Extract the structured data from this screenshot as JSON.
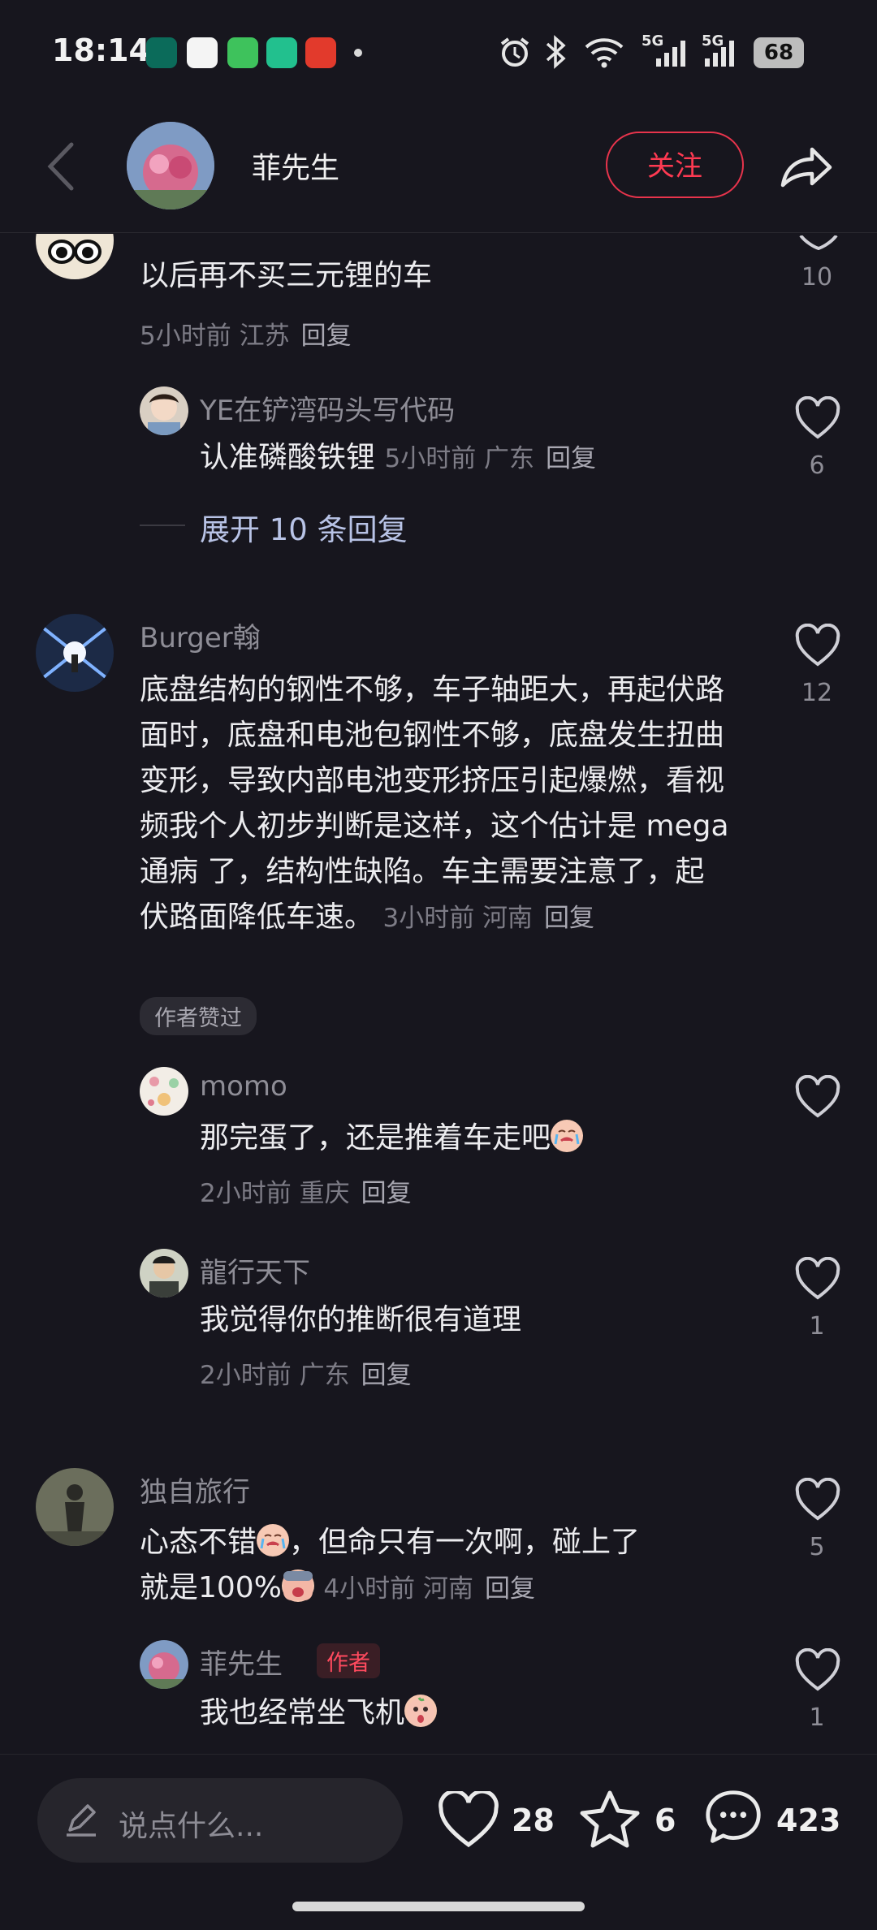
{
  "status_bar": {
    "time": "18:14",
    "net1": "5G",
    "net2": "5G",
    "battery": "68"
  },
  "header": {
    "author": "菲先生",
    "follow_label": "关注"
  },
  "comments": [
    {
      "text": "以后再不买三元锂的车",
      "meta": "5小时前 江苏",
      "reply": "回复",
      "likes": "10",
      "replies": [
        {
          "name": "YE在铲湾码头写代码",
          "text": "认准磷酸铁锂",
          "meta": "5小时前 广东",
          "reply": "回复",
          "likes": "6"
        }
      ],
      "expand": "展开 10 条回复"
    },
    {
      "name": "Burger翰",
      "text": "底盘结构的钢性不够，车子轴距大，再起伏路面时，底盘和电池包钢性不够，底盘发生扭曲变形，导致内部电池变形挤压引起爆燃，看视频我个人初步判断是这样，这个估计是 mega通病 了，结构性缺陷。车主需要注意了，起伏路面降低车速。",
      "meta": "3小时前 河南",
      "reply": "回复",
      "likes": "12",
      "badge": "作者赞过",
      "replies": [
        {
          "name": "momo",
          "text": "那完蛋了，还是推着车走吧",
          "meta": "2小时前 重庆",
          "reply": "回复",
          "likes": ""
        },
        {
          "name": "龍行天下",
          "text": "我觉得你的推断很有道理",
          "meta": "2小时前 广东",
          "reply": "回复",
          "likes": "1"
        }
      ]
    },
    {
      "name": "独自旅行",
      "text_a": "心态不错",
      "text_b": "，但命只有一次啊，碰上了",
      "text_c": "就是100%",
      "meta": "4小时前 河南",
      "reply": "回复",
      "likes": "5",
      "replies": [
        {
          "name": "菲先生",
          "tag": "作者",
          "text": "我也经常坐飞机",
          "likes": "1"
        }
      ]
    }
  ],
  "bottom_bar": {
    "placeholder": "说点什么...",
    "likes": "28",
    "favorites": "6",
    "comments": "423"
  },
  "colors": {
    "bg": "#17161e",
    "accent": "#ff3a52"
  }
}
